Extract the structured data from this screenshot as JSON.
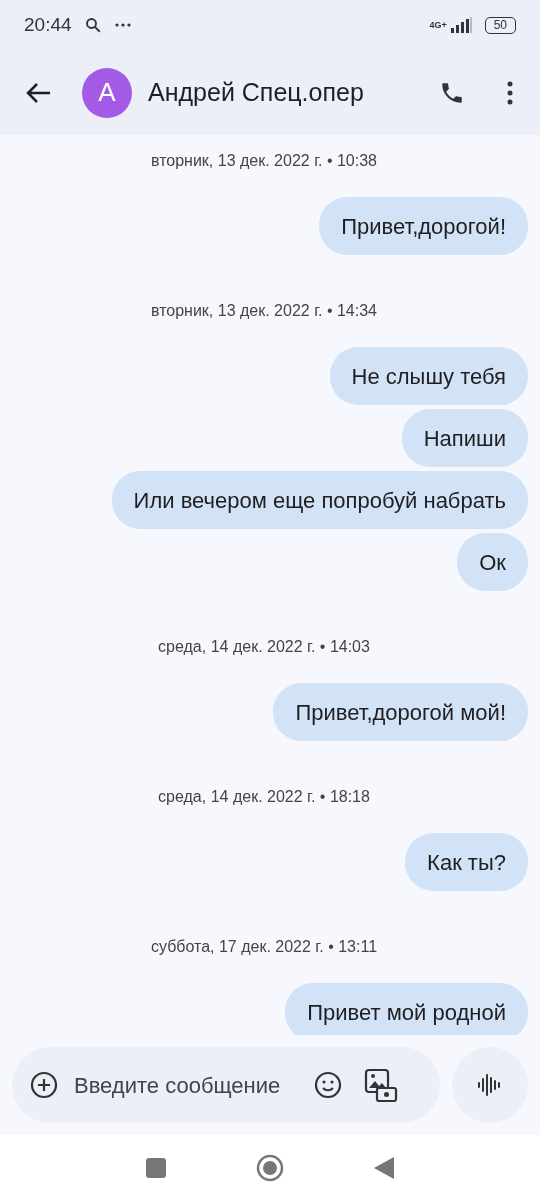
{
  "status_bar": {
    "time": "20:44",
    "network": "4G+",
    "battery": "50"
  },
  "header": {
    "avatar_letter": "A",
    "contact_name": "Андрей Спец.опер"
  },
  "messages": [
    {
      "kind": "date",
      "text": "вторник, 13 дек. 2022 г. • 10:38"
    },
    {
      "kind": "outgoing",
      "text": "Привет,дорогой!"
    },
    {
      "kind": "date",
      "text": "вторник, 13 дек. 2022 г. • 14:34"
    },
    {
      "kind": "outgoing",
      "text": "Не слышу тебя"
    },
    {
      "kind": "outgoing",
      "text": "Напиши"
    },
    {
      "kind": "outgoing",
      "text": "Или вечером еще попробуй набрать"
    },
    {
      "kind": "outgoing",
      "text": "Ок"
    },
    {
      "kind": "date",
      "text": "среда, 14 дек. 2022 г. • 14:03"
    },
    {
      "kind": "outgoing",
      "text": "Привет,дорогой мой!"
    },
    {
      "kind": "date",
      "text": "среда, 14 дек. 2022 г. • 18:18"
    },
    {
      "kind": "outgoing",
      "text": "Как ты?"
    },
    {
      "kind": "date",
      "text": "суббота, 17 дек. 2022 г. • 13:11"
    },
    {
      "kind": "outgoing",
      "text": "Привет мой родной"
    }
  ],
  "compose": {
    "placeholder": "Введите сообщение"
  }
}
